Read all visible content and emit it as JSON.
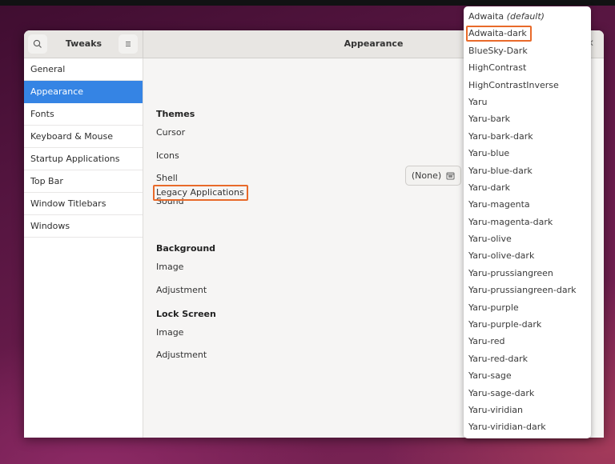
{
  "window": {
    "app_title": "Tweaks",
    "page_title": "Appearance"
  },
  "sidebar": {
    "items": [
      {
        "label": "General",
        "active": false
      },
      {
        "label": "Appearance",
        "active": true
      },
      {
        "label": "Fonts",
        "active": false
      },
      {
        "label": "Keyboard & Mouse",
        "active": false
      },
      {
        "label": "Startup Applications",
        "active": false
      },
      {
        "label": "Top Bar",
        "active": false
      },
      {
        "label": "Window Titlebars",
        "active": false
      },
      {
        "label": "Windows",
        "active": false
      }
    ]
  },
  "content": {
    "themes_heading": "Themes",
    "cursor": "Cursor",
    "icons": "Icons",
    "shell": "Shell",
    "shell_value": "(None)",
    "sound": "Sound",
    "legacy": "Legacy Applications",
    "background_heading": "Background",
    "bg_image": "Image",
    "bg_adjustment": "Adjustment",
    "lock_heading": "Lock Screen",
    "lock_image": "Image",
    "lock_adjustment": "Adjustment"
  },
  "dropdown": {
    "default_suffix": "(default)",
    "items": [
      "Adwaita",
      "Adwaita-dark",
      "BlueSky-Dark",
      "HighContrast",
      "HighContrastInverse",
      "Yaru",
      "Yaru-bark",
      "Yaru-bark-dark",
      "Yaru-blue",
      "Yaru-blue-dark",
      "Yaru-dark",
      "Yaru-magenta",
      "Yaru-magenta-dark",
      "Yaru-olive",
      "Yaru-olive-dark",
      "Yaru-prussiangreen",
      "Yaru-prussiangreen-dark",
      "Yaru-purple",
      "Yaru-purple-dark",
      "Yaru-red",
      "Yaru-red-dark",
      "Yaru-sage",
      "Yaru-sage-dark",
      "Yaru-viridian",
      "Yaru-viridian-dark"
    ],
    "highlighted": "Adwaita-dark"
  },
  "colors": {
    "accent": "#3584e4",
    "highlight_outline": "#e86a2a"
  }
}
